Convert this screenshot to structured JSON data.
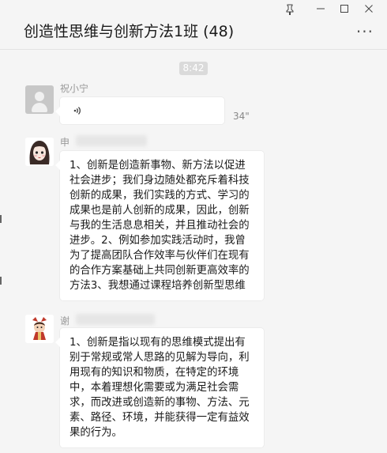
{
  "window": {
    "title": "创造性思维与创新方法1班 (48)",
    "controls": {
      "pin_glyph": "♀",
      "minimize_glyph": "─",
      "maximize_glyph": "☐",
      "close_glyph": "✕",
      "more_glyph": "···"
    }
  },
  "chat": {
    "time_divider": "8:42",
    "messages": [
      {
        "sender": "祝小宁",
        "type": "voice",
        "duration": "34\""
      },
      {
        "sender": "申",
        "type": "text",
        "text": "1、创新是创造新事物、新方法以促进社会进步；我们身边随处都充斥着科技创新的成果，我们实践的方式、学习的成果也是前人创新的成果，因此，创新与我的生活息息相关，并且推动社会的进步。2、例如参加实践活动时，我曾为了提高团队合作效率与伙伴们在现有的合作方案基础上共同创新更高效率的方法3、我想通过课程培养创新型思维"
      },
      {
        "sender": "谢",
        "type": "text",
        "text": "1、创新是指以现有的思维模式提出有别于常规或常人思路的见解为导向，利用现有的知识和物质，在特定的环境中，本着理想化需要或为满足社会需求，而改进或创造新的事物、方法、元素、路径、环境，并能获得一定有益效果的行为。"
      }
    ]
  },
  "colors": {
    "background": "#f5f5f5",
    "bubble": "#ffffff",
    "meta_text": "#999999"
  }
}
